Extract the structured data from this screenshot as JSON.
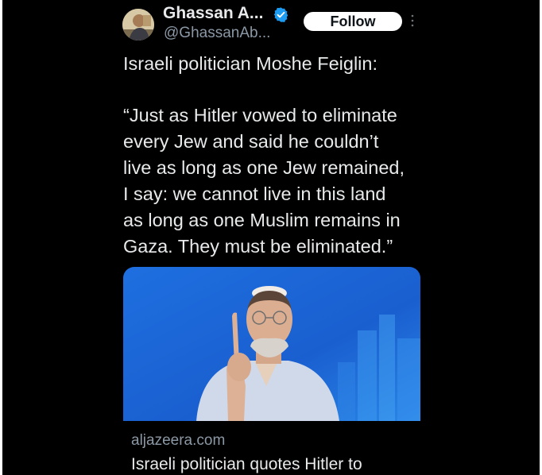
{
  "author": {
    "display_name": "Ghassan A...",
    "handle": "@GhassanAb...",
    "verified": true
  },
  "follow_label": "Follow",
  "tweet": {
    "paragraphs": [
      "Israeli politician Moshe Feiglin:",
      "“Just as Hitler vowed to eliminate",
      "every Jew and said he couldn’t",
      "live as long as one Jew remained,",
      "I say: we cannot live in this land",
      "as long as one Muslim remains in",
      "Gaza. They must be eliminated.”"
    ]
  },
  "card": {
    "domain": "aljazeera.com",
    "title": "Israeli politician quotes Hitler to"
  },
  "colors": {
    "background": "#000000",
    "text": "#e7e9ea",
    "secondary_text": "#8b98a5",
    "verified_badge": "#1d9bf0",
    "follow_bg": "#ffffff"
  },
  "icons": {
    "verified": "verified-badge-icon",
    "more": "more-options-icon"
  }
}
